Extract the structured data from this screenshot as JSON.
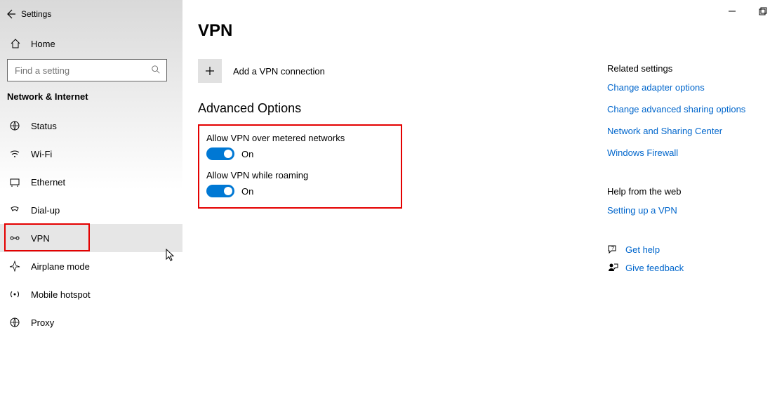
{
  "window": {
    "title": "Settings"
  },
  "sidebar": {
    "home_label": "Home",
    "search_placeholder": "Find a setting",
    "section_header": "Network & Internet",
    "items": [
      {
        "label": "Status",
        "selected": false
      },
      {
        "label": "Wi-Fi",
        "selected": false
      },
      {
        "label": "Ethernet",
        "selected": false
      },
      {
        "label": "Dial-up",
        "selected": false
      },
      {
        "label": "VPN",
        "selected": true
      },
      {
        "label": "Airplane mode",
        "selected": false
      },
      {
        "label": "Mobile hotspot",
        "selected": false
      },
      {
        "label": "Proxy",
        "selected": false
      }
    ]
  },
  "page": {
    "title": "VPN",
    "add_label": "Add a VPN connection",
    "advanced_header": "Advanced Options",
    "toggles": [
      {
        "label": "Allow VPN over metered networks",
        "state_label": "On"
      },
      {
        "label": "Allow VPN while roaming",
        "state_label": "On"
      }
    ]
  },
  "right": {
    "related_header": "Related settings",
    "related_links": [
      "Change adapter options",
      "Change advanced sharing options",
      "Network and Sharing Center",
      "Windows Firewall"
    ],
    "help_header": "Help from the web",
    "help_links": [
      "Setting up a VPN"
    ],
    "get_help": "Get help",
    "give_feedback": "Give feedback"
  }
}
